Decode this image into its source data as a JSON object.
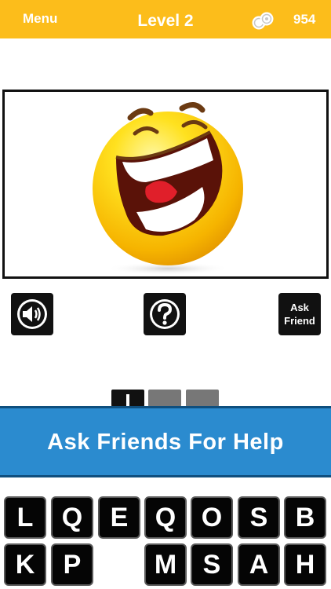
{
  "header": {
    "menu_label": "Menu",
    "level_label": "Level 2",
    "coins": "954",
    "coin_icon": "coins-icon",
    "background_color": "#fcbd1b"
  },
  "puzzle": {
    "image": "laughing-emoji-icon"
  },
  "tools": {
    "sound_icon": "speaker-icon",
    "hint_icon": "question-mark-icon",
    "ask_label_line1": "Ask",
    "ask_label_line2": "Friend"
  },
  "answer": {
    "slots": [
      {
        "state": "filled",
        "color": "#111111"
      },
      {
        "state": "empty",
        "color": "#777777"
      },
      {
        "state": "empty",
        "color": "#777777"
      }
    ]
  },
  "banner": {
    "text": "Ask Friends For Help",
    "color": "#2b8bcf"
  },
  "keyboard": {
    "rows": [
      [
        "L",
        "Q",
        "E",
        "Q",
        "O",
        "S",
        "B"
      ],
      [
        "K",
        "P",
        "",
        "M",
        "S",
        "A",
        "H"
      ]
    ]
  }
}
